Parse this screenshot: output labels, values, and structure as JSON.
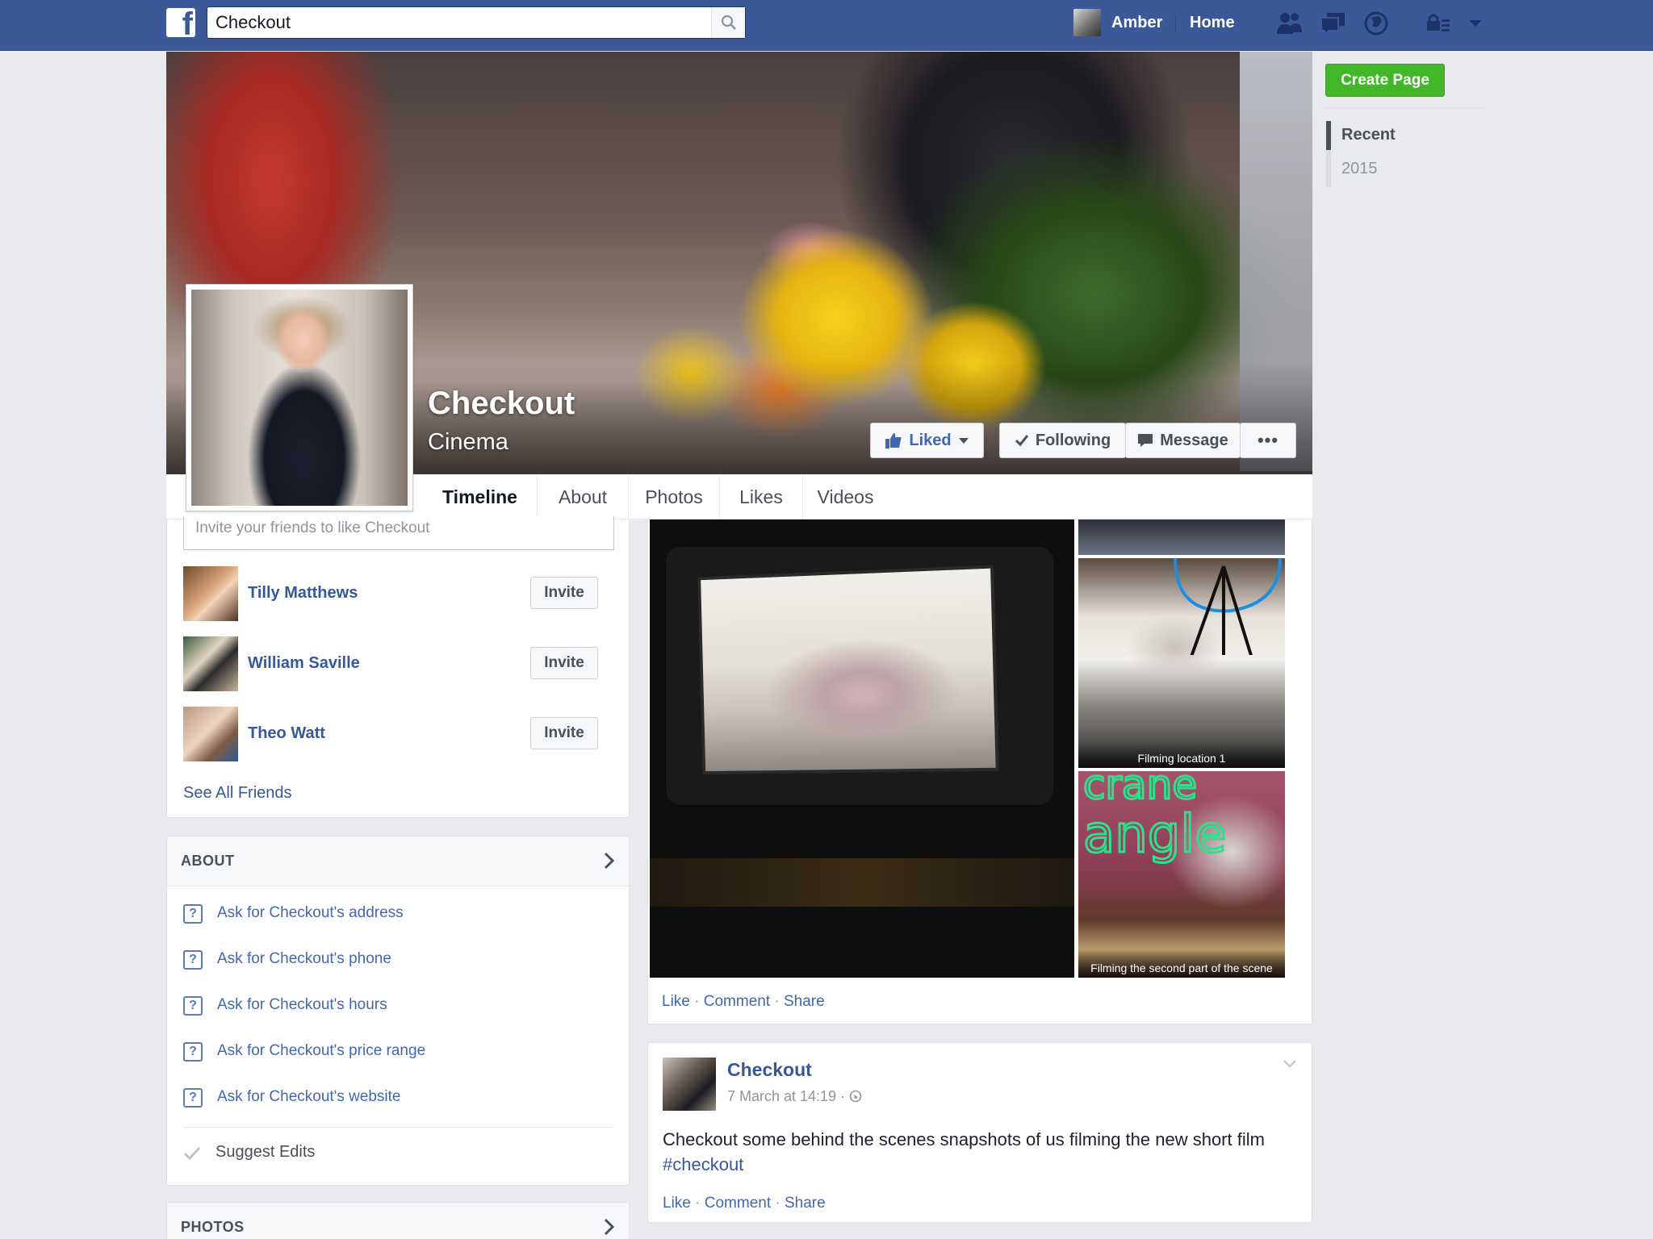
{
  "topbar": {
    "search_value": "Checkout",
    "user_name": "Amber",
    "home_label": "Home",
    "icons": [
      "facebook-logo",
      "search-icon",
      "friend-requests-icon",
      "messages-icon",
      "notifications-globe-icon",
      "privacy-shortcuts-icon",
      "account-menu-caret-icon"
    ],
    "brand_color": "#3b5998"
  },
  "page": {
    "name": "Checkout",
    "category": "Cinema"
  },
  "actions": {
    "liked": "Liked",
    "following": "Following",
    "message": "Message",
    "more": "•••"
  },
  "tabs": [
    "Timeline",
    "About",
    "Photos",
    "Likes",
    "Videos"
  ],
  "invite": {
    "placeholder": "Invite your friends to like Checkout",
    "friends": [
      {
        "name": "Tilly Matthews",
        "button": "Invite"
      },
      {
        "name": "William Saville",
        "button": "Invite"
      },
      {
        "name": "Theo Watt",
        "button": "Invite"
      }
    ],
    "see_all": "See All Friends"
  },
  "about": {
    "title": "ABOUT",
    "asks": [
      "Ask for Checkout's address",
      "Ask for Checkout's phone",
      "Ask for Checkout's hours",
      "Ask for Checkout's price range",
      "Ask for Checkout's website"
    ],
    "suggest": "Suggest Edits"
  },
  "photos_section": {
    "title": "PHOTOS"
  },
  "photo_post": {
    "captions": [
      "Filming location 1",
      "Filming the second part of the scene"
    ],
    "overlay_text": [
      "crane",
      "angle"
    ],
    "like": "Like",
    "comment": "Comment",
    "share": "Share",
    "sep": "·"
  },
  "text_post": {
    "author": "Checkout",
    "time": "7 March at 14:19 ·",
    "text": "Checkout some behind the scenes snapshots of us filming the new short film ",
    "hashtag": "#checkout",
    "like": "Like",
    "comment": "Comment",
    "share": "Share",
    "sep": "·"
  },
  "right_sidebar": {
    "create_page": "Create Page",
    "years": [
      {
        "label": "Recent",
        "active": true
      },
      {
        "label": "2015",
        "active": false
      }
    ],
    "accent_color": "#42b72a"
  }
}
